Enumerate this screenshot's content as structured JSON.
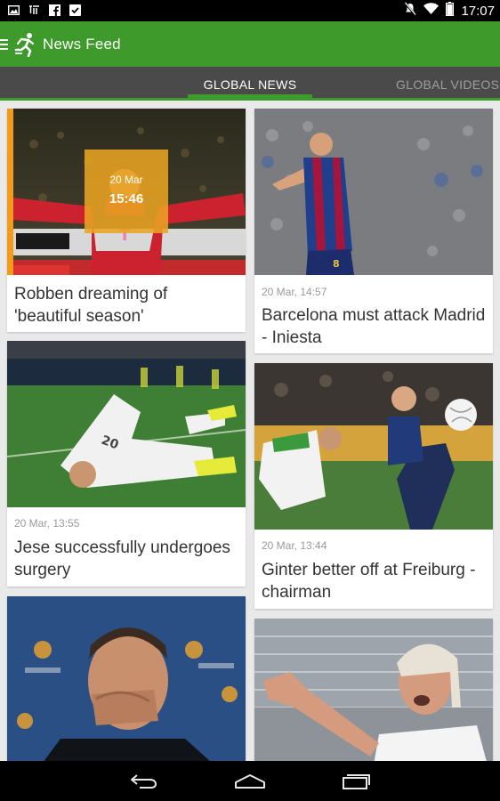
{
  "status_bar": {
    "time": "17:07",
    "left_icons": [
      "image-icon",
      "tumblr-icon",
      "facebook-icon",
      "checkbox-icon"
    ],
    "right_icons": [
      "mute-icon",
      "wifi-icon",
      "battery-icon"
    ]
  },
  "app_bar": {
    "title": "News Feed",
    "menu_icon": "menu-icon",
    "logo_icon": "runner-icon"
  },
  "tabs": [
    {
      "label": "GLOBAL NEWS",
      "active": true
    },
    {
      "label": "GLOBAL VIDEOS",
      "active": false
    }
  ],
  "featured_badge": {
    "date": "20 Mar",
    "time": "15:46"
  },
  "articles": [
    {
      "headline": "Robben dreaming of 'beautiful season'",
      "meta": "",
      "photo": "player-celebrating-red-kit"
    },
    {
      "headline": "Barcelona must attack Madrid - Iniesta",
      "meta": "20 Mar, 14:57",
      "photo": "player-barcelona-kit"
    },
    {
      "headline": "Jese successfully undergoes surgery",
      "meta": "20 Mar, 13:55",
      "photo": "player-injured-on-grass"
    },
    {
      "headline": "Ginter better off at Freiburg - chairman",
      "meta": "20 Mar, 13:44",
      "photo": "players-challenging-for-ball"
    },
    {
      "headline": "",
      "meta": "",
      "photo": "coach-hand-over-mouth"
    },
    {
      "headline": "",
      "meta": "",
      "photo": "coach-shouting-in-stadium"
    }
  ],
  "colors": {
    "app_bar": "#3d9a2b",
    "tab_bar": "#4a4a4a",
    "accent": "#f39a1a",
    "badge": "#e9a321"
  },
  "nav_bar": {
    "buttons": [
      "back-icon",
      "home-icon",
      "recents-icon"
    ]
  }
}
